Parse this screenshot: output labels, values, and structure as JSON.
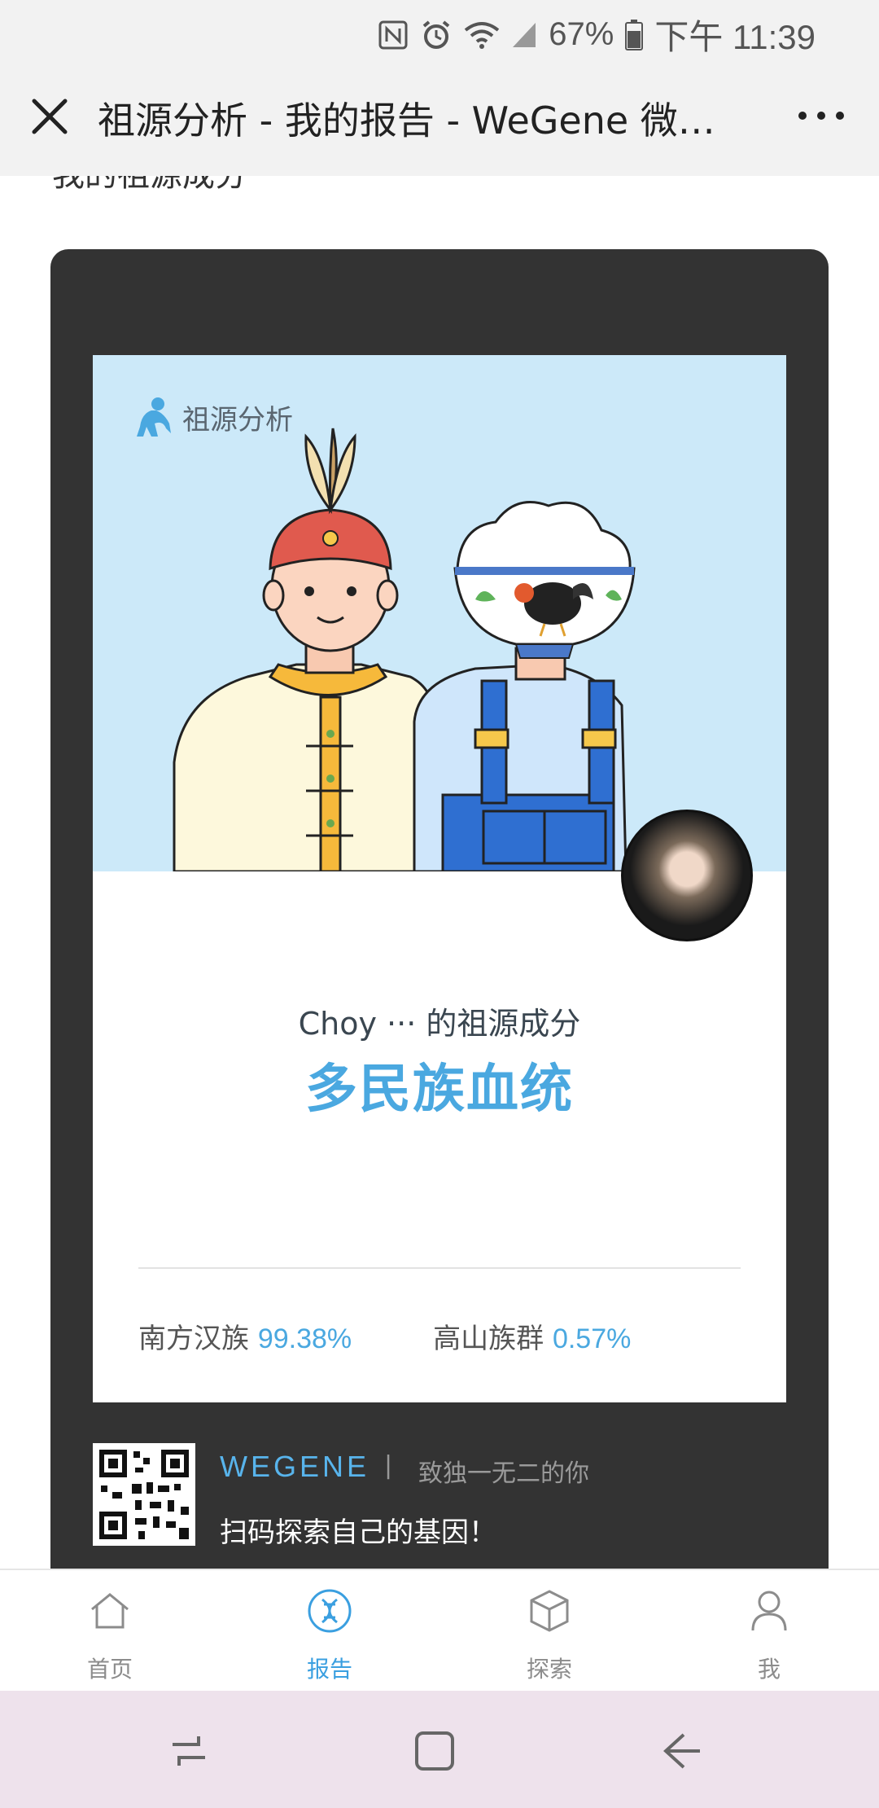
{
  "status": {
    "battery_pct": "67%",
    "time": "下午 11:39"
  },
  "header": {
    "title": "祖源分析 - 我的报告 - WeGene 微…"
  },
  "page": {
    "heading": "我的祖源成分"
  },
  "report": {
    "brand_label": "祖源分析",
    "owner_line": "Choy ··· 的祖源成分",
    "result_title": "多民族血统",
    "stats": [
      {
        "label": "南方汉族",
        "value": "99.38%"
      },
      {
        "label": "高山族群",
        "value": "0.57%"
      }
    ]
  },
  "footer": {
    "brand": "WEGENE",
    "separator": "|",
    "slogan": "致独一无二的你",
    "scan_text": "扫码探索自己的基因！"
  },
  "tabbar": {
    "items": [
      {
        "label": "首页",
        "icon": "home-icon"
      },
      {
        "label": "报告",
        "icon": "dna-icon"
      },
      {
        "label": "探索",
        "icon": "cube-icon"
      },
      {
        "label": "我",
        "icon": "user-icon"
      }
    ],
    "active": "报告"
  },
  "colors": {
    "accent": "#4aa8e0",
    "card_dark": "#333333",
    "illustration_bg": "#cce9f9"
  }
}
